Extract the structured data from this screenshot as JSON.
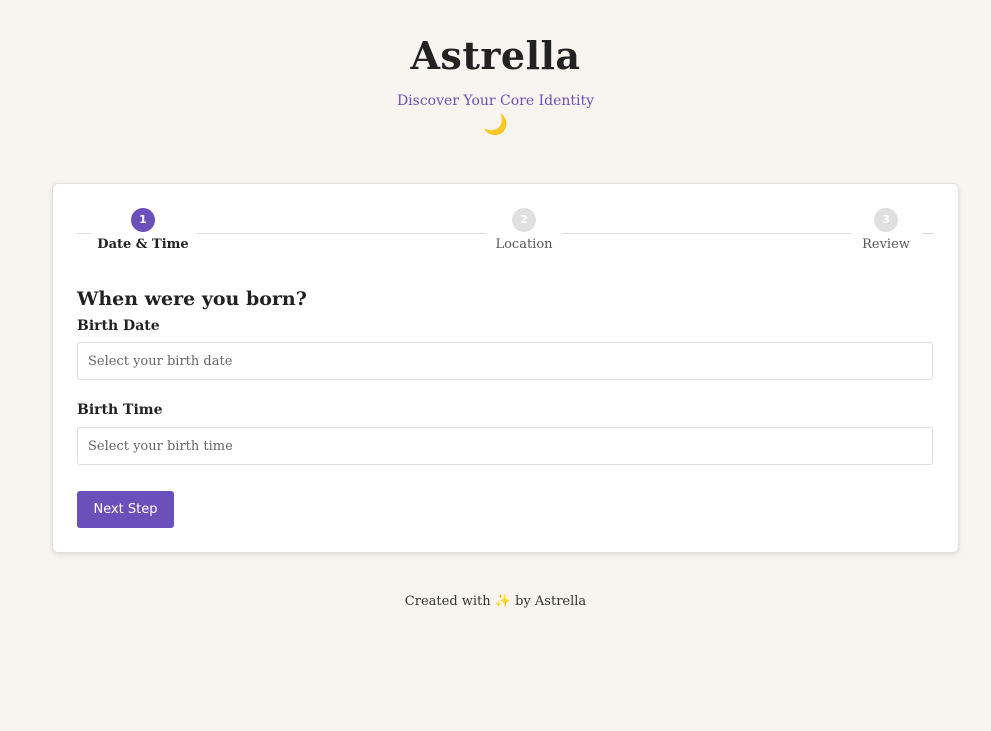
{
  "header": {
    "title": "Astrella",
    "subtitle": "Discover Your Core Identity",
    "moon_glyph": "🌙"
  },
  "stepper": {
    "steps": [
      {
        "number": "1",
        "label": "Date & Time",
        "state": "active"
      },
      {
        "number": "2",
        "label": "Location",
        "state": "inactive"
      },
      {
        "number": "3",
        "label": "Review",
        "state": "inactive"
      }
    ]
  },
  "form": {
    "title": "When were you born?",
    "birth_date": {
      "label": "Birth Date",
      "placeholder": "Select your birth date",
      "value": ""
    },
    "birth_time": {
      "label": "Birth Time",
      "placeholder": "Select your birth time",
      "value": ""
    },
    "next_label": "Next Step"
  },
  "footer": {
    "prefix": "Created with",
    "sparkle_glyph": "✨",
    "suffix": "by Astrella"
  },
  "colors": {
    "accent": "#6b4fbb",
    "background": "#f8f5f0",
    "card": "#ffffff",
    "inactive_step": "#e0e0e0"
  }
}
